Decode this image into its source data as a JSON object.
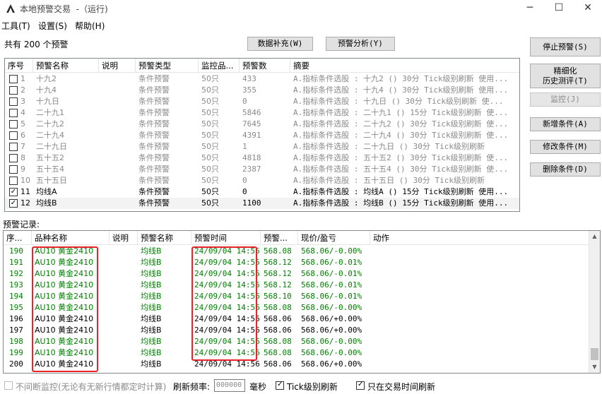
{
  "window": {
    "title": "本地预警交易  -（运行)",
    "min_icon": "─",
    "max_icon": "☐",
    "close_icon": "✕"
  },
  "menu": [
    "工具(T)",
    "设置(S)",
    "帮助(H)"
  ],
  "summary": "共有 200 个预警",
  "buttons": {
    "data_supplement": "数据补充(W)",
    "warning_analysis": "预警分析(Y)",
    "stop_warning": "停止预警(S)",
    "refine_line1": "精细化",
    "refine_line2": "历史测评(T)",
    "monitor": "监控(J)",
    "add_condition": "新增条件(A)",
    "modify_condition": "修改条件(M)",
    "delete_condition": "删除条件(D)"
  },
  "alerts_table": {
    "columns": [
      "序号",
      "预警名称",
      "说明",
      "预警类型",
      "监控品...",
      "预警数",
      "摘要"
    ],
    "rows": [
      {
        "checked": false,
        "active": false,
        "no": "1",
        "name": "十九2",
        "desc": "",
        "type": "条件预警",
        "monitor": "50只",
        "count": "433",
        "summary": "A.指标条件选股 : 十九2 () 30分 Tick级别刷新 使用..."
      },
      {
        "checked": false,
        "active": false,
        "no": "2",
        "name": "十九4",
        "desc": "",
        "type": "条件预警",
        "monitor": "50只",
        "count": "355",
        "summary": "A.指标条件选股 : 十九4 () 30分 Tick级别刷新 使用..."
      },
      {
        "checked": false,
        "active": false,
        "no": "3",
        "name": "十九日",
        "desc": "",
        "type": "条件预警",
        "monitor": "50只",
        "count": "0",
        "summary": "A.指标条件选股 : 十九日 () 30分 Tick级别刷新 使..."
      },
      {
        "checked": false,
        "active": false,
        "no": "4",
        "name": "二十九1",
        "desc": "",
        "type": "条件预警",
        "monitor": "50只",
        "count": "5846",
        "summary": "A.指标条件选股 : 二十九1 () 15分 Tick级别刷新 使..."
      },
      {
        "checked": false,
        "active": false,
        "no": "5",
        "name": "二十九2",
        "desc": "",
        "type": "条件预警",
        "monitor": "50只",
        "count": "7645",
        "summary": "A.指标条件选股 : 二十九2 () 30分 Tick级别刷新 使..."
      },
      {
        "checked": false,
        "active": false,
        "no": "6",
        "name": "二十九4",
        "desc": "",
        "type": "条件预警",
        "monitor": "50只",
        "count": "4391",
        "summary": "A.指标条件选股 : 二十九4 () 30分 Tick级别刷新 使..."
      },
      {
        "checked": false,
        "active": false,
        "no": "7",
        "name": "二十九日",
        "desc": "",
        "type": "条件预警",
        "monitor": "50只",
        "count": "1",
        "summary": "A.指标条件选股 : 二十九日 () 30分 Tick级别刷新"
      },
      {
        "checked": false,
        "active": false,
        "no": "8",
        "name": "五十五2",
        "desc": "",
        "type": "条件预警",
        "monitor": "50只",
        "count": "4818",
        "summary": "A.指标条件选股 : 五十五2 () 30分 Tick级别刷新 使..."
      },
      {
        "checked": false,
        "active": false,
        "no": "9",
        "name": "五十五4",
        "desc": "",
        "type": "条件预警",
        "monitor": "50只",
        "count": "2387",
        "summary": "A.指标条件选股 : 五十五4 () 30分 Tick级别刷新 使..."
      },
      {
        "checked": false,
        "active": false,
        "no": "10",
        "name": "五十五日",
        "desc": "",
        "type": "条件预警",
        "monitor": "50只",
        "count": "0",
        "summary": "A.指标条件选股 : 五十五日 () 30分 Tick级别刷新"
      },
      {
        "checked": true,
        "active": true,
        "no": "11",
        "name": "均线A",
        "desc": "",
        "type": "条件预警",
        "monitor": "50只",
        "count": "0",
        "summary": "A.指标条件选股 : 均线A () 15分 Tick级别刷新 使用..."
      },
      {
        "checked": true,
        "active": true,
        "no": "12",
        "name": "均线B",
        "desc": "",
        "type": "条件预警",
        "monitor": "50只",
        "count": "1100",
        "summary": "A.指标条件选股 : 均线B () 15分 Tick级别刷新 使用..."
      }
    ]
  },
  "records_label": "预警记录:",
  "records_table": {
    "columns": [
      "序...",
      "品种名称",
      "说明",
      "预警名称",
      "预警时间",
      "预警...",
      "现价/盈亏",
      "动作"
    ],
    "rows": [
      {
        "no": "190",
        "color": "green",
        "product": "AU10 黄金2410",
        "desc": "",
        "warn": "均线B",
        "time": "24/09/04 14:55",
        "price": "568.08",
        "pl": "568.06/-0.00%",
        "action": ""
      },
      {
        "no": "191",
        "color": "green",
        "product": "AU10 黄金2410",
        "desc": "",
        "warn": "均线B",
        "time": "24/09/04 14:55",
        "price": "568.12",
        "pl": "568.06/-0.01%",
        "action": ""
      },
      {
        "no": "192",
        "color": "green",
        "product": "AU10 黄金2410",
        "desc": "",
        "warn": "均线B",
        "time": "24/09/04 14:55",
        "price": "568.12",
        "pl": "568.06/-0.01%",
        "action": ""
      },
      {
        "no": "193",
        "color": "green",
        "product": "AU10 黄金2410",
        "desc": "",
        "warn": "均线B",
        "time": "24/09/04 14:55",
        "price": "568.12",
        "pl": "568.06/-0.01%",
        "action": ""
      },
      {
        "no": "194",
        "color": "green",
        "product": "AU10 黄金2410",
        "desc": "",
        "warn": "均线B",
        "time": "24/09/04 14:56",
        "price": "568.10",
        "pl": "568.06/-0.01%",
        "action": ""
      },
      {
        "no": "195",
        "color": "green",
        "product": "AU10 黄金2410",
        "desc": "",
        "warn": "均线B",
        "time": "24/09/04 14:56",
        "price": "568.08",
        "pl": "568.06/-0.00%",
        "action": ""
      },
      {
        "no": "196",
        "color": "black",
        "product": "AU10 黄金2410",
        "desc": "",
        "warn": "均线B",
        "time": "24/09/04 14:56",
        "price": "568.06",
        "pl": "568.06/+0.00%",
        "action": ""
      },
      {
        "no": "197",
        "color": "black",
        "product": "AU10 黄金2410",
        "desc": "",
        "warn": "均线B",
        "time": "24/09/04 14:56",
        "price": "568.06",
        "pl": "568.06/+0.00%",
        "action": ""
      },
      {
        "no": "198",
        "color": "green",
        "product": "AU10 黄金2410",
        "desc": "",
        "warn": "均线B",
        "time": "24/09/04 14:56",
        "price": "568.08",
        "pl": "568.06/-0.00%",
        "action": ""
      },
      {
        "no": "199",
        "color": "green",
        "product": "AU10 黄金2410",
        "desc": "",
        "warn": "均线B",
        "time": "24/09/04 14:56",
        "price": "568.08",
        "pl": "568.06/-0.00%",
        "action": ""
      },
      {
        "no": "200",
        "color": "black",
        "product": "AU10 黄金2410",
        "desc": "",
        "warn": "均线B",
        "time": "24/09/04 14:56",
        "price": "568.06",
        "pl": "568.06/+0.00%",
        "action": ""
      }
    ]
  },
  "status": {
    "continuous_monitor": "不间断监控(无论有无新行情都定时计算)",
    "continuous_monitor_checked": false,
    "refresh_label": "刷新频率:",
    "refresh_value": "000000",
    "refresh_unit": "毫秒",
    "tick_refresh": "Tick级别刷新",
    "tick_refresh_checked": true,
    "trade_time_only": "只在交易时间刷新",
    "trade_time_only_checked": true
  },
  "colors": {
    "green_text": "#008000",
    "gray_text": "#8a8a8a",
    "highlight_border": "#e8232a"
  }
}
